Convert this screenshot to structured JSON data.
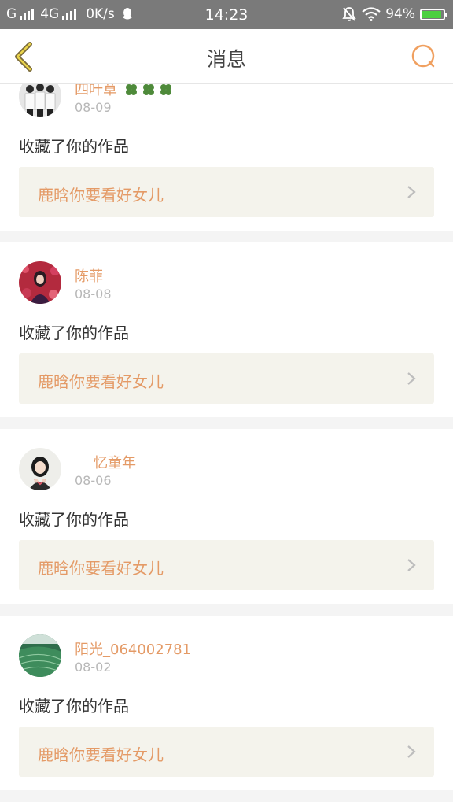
{
  "status_bar": {
    "carrier1": "G",
    "carrier2": "4G",
    "speed": "0K/s",
    "time": "14:23",
    "battery": "94%",
    "battery_level": 0.94,
    "battery_color": "#4cd040"
  },
  "header": {
    "back_icon": "chevron-left-icon",
    "title": "消息",
    "search_icon": "search-icon"
  },
  "accent_color": "#e49a66",
  "notifications": [
    {
      "user": "四叶草",
      "date": "08-09",
      "action": "收藏了你的作品",
      "work": "鹿晗你要看好女儿"
    },
    {
      "user": "陈菲",
      "date": "08-08",
      "action": "收藏了你的作品",
      "work": "鹿晗你要看好女儿"
    },
    {
      "user": "忆童年",
      "date": "08-06",
      "action": "收藏了你的作品",
      "work": "鹿晗你要看好女儿"
    },
    {
      "user": "阳光_064002781",
      "date": "08-02",
      "action": "收藏了你的作品",
      "work": "鹿晗你要看好女儿"
    }
  ]
}
